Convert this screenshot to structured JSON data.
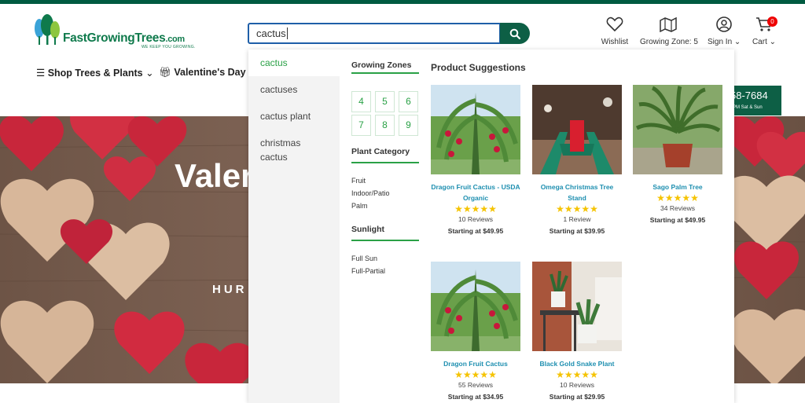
{
  "header": {
    "logo_name": "FastGrowingTrees",
    "logo_com": ".com",
    "logo_tagline": "WE KEEP YOU GROWING.",
    "search_value": "cactus",
    "wishlist": "Wishlist",
    "growing_zone": "Growing Zone: 5",
    "sign_in": "Sign In",
    "cart": "Cart",
    "cart_count": "0"
  },
  "nav": {
    "shop": "Shop Trees & Plants",
    "valentines": "Valentine's Day G",
    "phone": "58-7684",
    "phone_hours": "PM Sat & Sun"
  },
  "hero": {
    "title": "Valer",
    "subtitle": "HUR"
  },
  "dropdown": {
    "suggestions": [
      "cactus",
      "cactuses",
      "cactus plant",
      "christmas",
      "cactus"
    ],
    "growing_zones_title": "Growing Zones",
    "zones": [
      "4",
      "5",
      "6",
      "7",
      "8",
      "9"
    ],
    "plant_category_title": "Plant Category",
    "categories": [
      "Fruit",
      "Indoor/Patio",
      "Palm"
    ],
    "sunlight_title": "Sunlight",
    "sunlight": [
      "Full Sun",
      "Full-Partial"
    ],
    "product_suggestions_title": "Product Suggestions",
    "products": [
      {
        "name1": "Dragon Fruit Cactus - USDA",
        "name2": "Organic",
        "stars": "★★★★★",
        "reviews": "10 Reviews",
        "price": "Starting at $49.95"
      },
      {
        "name1": "Omega Christmas Tree",
        "name2": "Stand",
        "stars": "★★★★★",
        "reviews": "1 Review",
        "price": "Starting at $39.95"
      },
      {
        "name1": "Sago Palm Tree",
        "name2": "",
        "stars": "★★★★★",
        "reviews": "34 Reviews",
        "price": "Starting at $49.95"
      },
      {
        "name1": "Dragon Fruit Cactus",
        "name2": "",
        "stars": "★★★★★",
        "reviews": "55 Reviews",
        "price": "Starting at $34.95"
      },
      {
        "name1": "Black Gold Snake Plant",
        "name2": "",
        "stars": "★★★★★",
        "reviews": "10 Reviews",
        "price": "Starting at $29.95"
      }
    ]
  },
  "colors": {
    "brand_green": "#0d5f45",
    "accent_green": "#2aa146",
    "link_blue": "#1e8fb0",
    "star_yellow": "#f5c300"
  }
}
